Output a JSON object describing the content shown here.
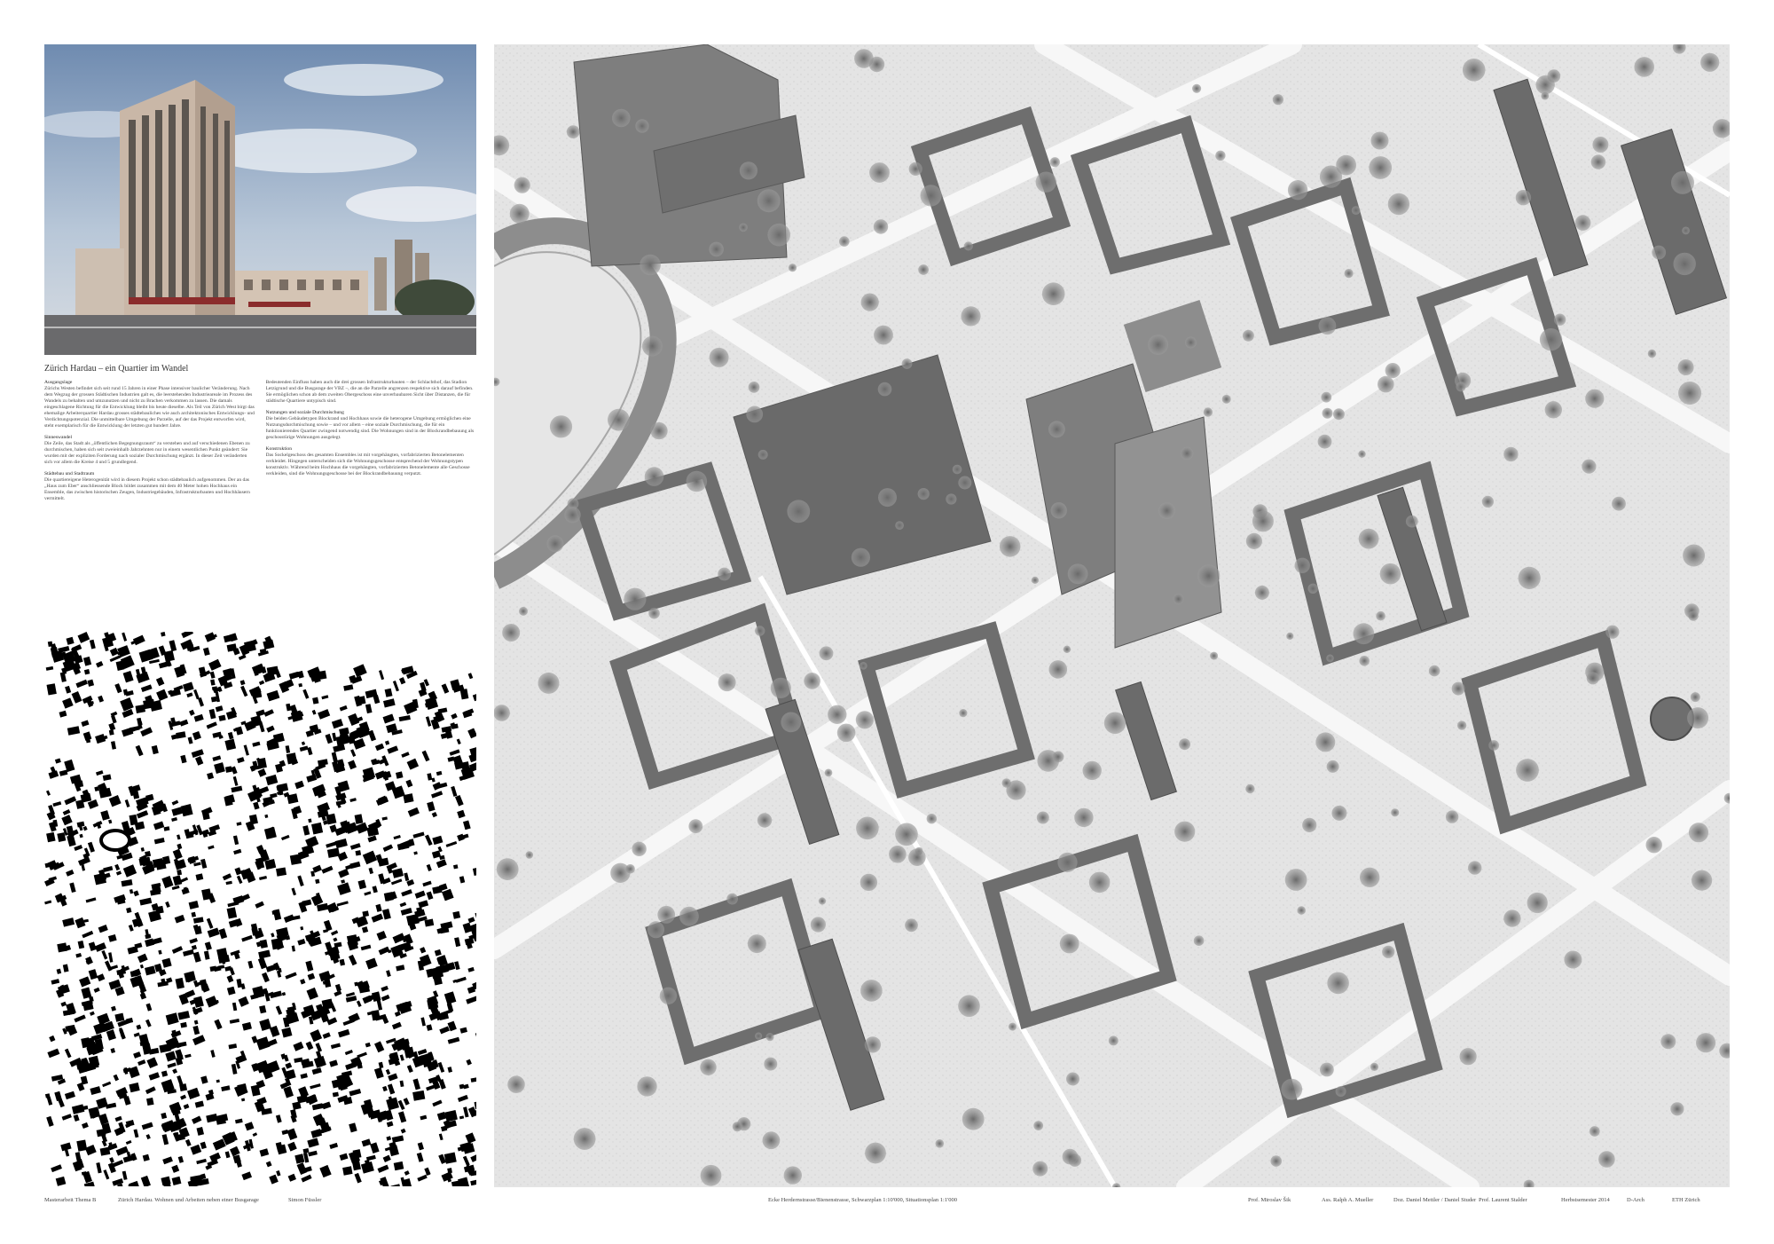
{
  "intro_title": "Zürich Hardau – ein Quartier im Wandel",
  "sections": {
    "ausgangslage_heading": "Ausgangslage",
    "ausgangslage_text": "Zürichs Westen befindet sich seit rund 15 Jahren in einer Phase intensiver baulicher Veränderung. Nach dem Wegzug der grossen Städtischen Industrien galt es, die leerstehenden Industrieareale im Prozess des Wandels zu behalten und umzunutzen und nicht zu Brachen verkommen zu lassen. Die damals eingeschlagene Richtung für die Entwicklung bleibt bis heute dieselbe. Als Teil von Zürich West birgt das ehemalige Arbeiterquartier Hardau grosses städtebauliches wie auch architektonisches Entwicklungs- und Verdichtungspotenzial. Die unmittelbare Umgebung der Parzelle, auf der das Projekt entworfen wird, steht exemplarisch für die Entwicklung der letzten gut hundert Jahre.",
    "sinneswandel_heading": "Sinneswandel",
    "sinneswandel_text": "Die Zeile, das Stadt als „öffentlichen Begegnungsraum“ zu verstehen und auf verschiedenen Ebenen zu durchmischen, haben sich seit zweieinhalb Jahrzehnten nur in einem wesentlichen Punkt geändert: Sie wurden mit der expliziten Forderung nach sozialer Durchmischung ergänzt. In dieser Zeit veränderten sich vor allem die Kreise 4 und 5 grundlegend.",
    "staedtebau_heading": "Städtebau und Stadtraum",
    "staedtebau_text": "Die quartiereigene Heterogenität wird in diesem Projekt schon städtebaulich aufgenommen. Der an das „Haus zum Eber“ anschliessende Block bildet zusammen mit dem 40 Meter hohen Hochhaus ein Ensemble, das zwischen historischen Zeugen, Industriegebäuden, Infrastrukturbauten und Hochhäusern vermittelt.",
    "einfluss_text": "Bedeutenden Einfluss haben auch die drei grossen Infrastrukturbauten – der Schlachthof, das Stadion Letzigrund und die Busgarage der VBZ –, die an die Parzelle angrenzen respektive sich darauf befinden. Sie ermöglichen schon ab dem zweiten Obergeschoss eine unverbaubaren Sicht über Distanzen, die für städtische Quartiere untypisch sind.",
    "nutzungen_heading": "Nutzungen und soziale Durchmischung",
    "nutzungen_text": "Die beiden Gebäudetypen Blockrand und Hochhaus sowie die heterogene Umgebung ermöglichen eine Nutzungsdurchmischung sowie – und vor allem – eine soziale Durchmischung, die für ein funktionierendes Quartier zwingend notwendig sind. Die Wohnungen sind in der Blockrandbebauung als geschosstürige Wohnungen ausgelegt.",
    "konstruktion_heading": "Konstruktion",
    "konstruktion_text": "Das Sockelgeschoss des gesamten Ensembles ist mit vorgehängten, vorfabrizierten Betonelementen verkleidet. Hingegen unterscheiden sich die Wohnungsgeschosse entsprechend der Wohnungstypen konstruktiv. Während beim Hochhaus die vorgehängten, vorfabrizierten Betonelemente alle Geschosse verkleiden, sind die Wohnungsgeschosse bei der Blockrandbebauung verputzt."
  },
  "footer": {
    "masterarbeit": "Masterarbeit Thema B",
    "project_title": "Zürich Hardau. Wohnen und Arbeiten neben einer Busgarage",
    "author": "Simon Füssler",
    "plan_caption": "Ecke Herdernstrasse/Bienenstrasse, Schwarzplan 1:10'000, Situationsplan 1:1'000",
    "prof": "Prof. Miroslav Šik",
    "assistant": "Ass. Ralph A. Mueller",
    "dozenten": "Doz. Daniel Mettler / Daniel Studer",
    "prof2": "Prof. Laurent Stalder",
    "semester": "Herbstsemester 2014",
    "department": "D-Arch",
    "institution": "ETH Zürich"
  }
}
